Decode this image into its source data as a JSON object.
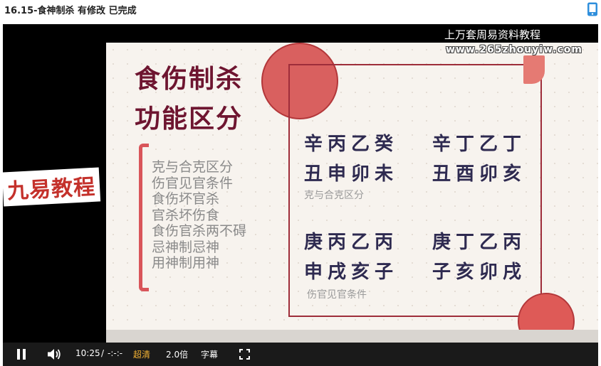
{
  "page": {
    "title": "16.15-食神制杀 有修改 已完成",
    "phone_icon": "mobile-phone-icon"
  },
  "video": {
    "watermark_title": "上万套周易资料教程",
    "watermark_url": "www.265zhouyiw.com",
    "brand": "九易教程",
    "slide": {
      "heading_line1": "食伤制杀",
      "heading_line2": "功能区分",
      "topics": [
        "克与合克区分",
        "伤官见官条件",
        "食伤坏官杀",
        "官杀坏伤食",
        "食伤官杀两不碍",
        "忌神制忌神",
        "用神制用神"
      ],
      "example1": {
        "left": [
          "辛丙乙癸",
          "丑申卯未"
        ],
        "right": [
          "辛丁乙丁",
          "丑酉卯亥"
        ],
        "caption": "克与合克区分"
      },
      "example2": {
        "left": [
          "庚丙乙丙",
          "申戌亥子"
        ],
        "right": [
          "庚丁乙丙",
          "子亥卯戌"
        ],
        "caption": "伤官见官条件"
      }
    },
    "controls": {
      "play_pause_icon": "pause-icon",
      "volume_icon": "volume-icon",
      "current_time": "10:25",
      "separator": "/",
      "duration": "-:-:-",
      "quality": "超清",
      "speed": "2.0倍",
      "subtitles": "字幕",
      "fullscreen_icon": "fullscreen-icon"
    },
    "colors": {
      "accent_red": "#d9605f",
      "heading": "#6e1530",
      "quality_highlight": "#f2b233"
    }
  }
}
